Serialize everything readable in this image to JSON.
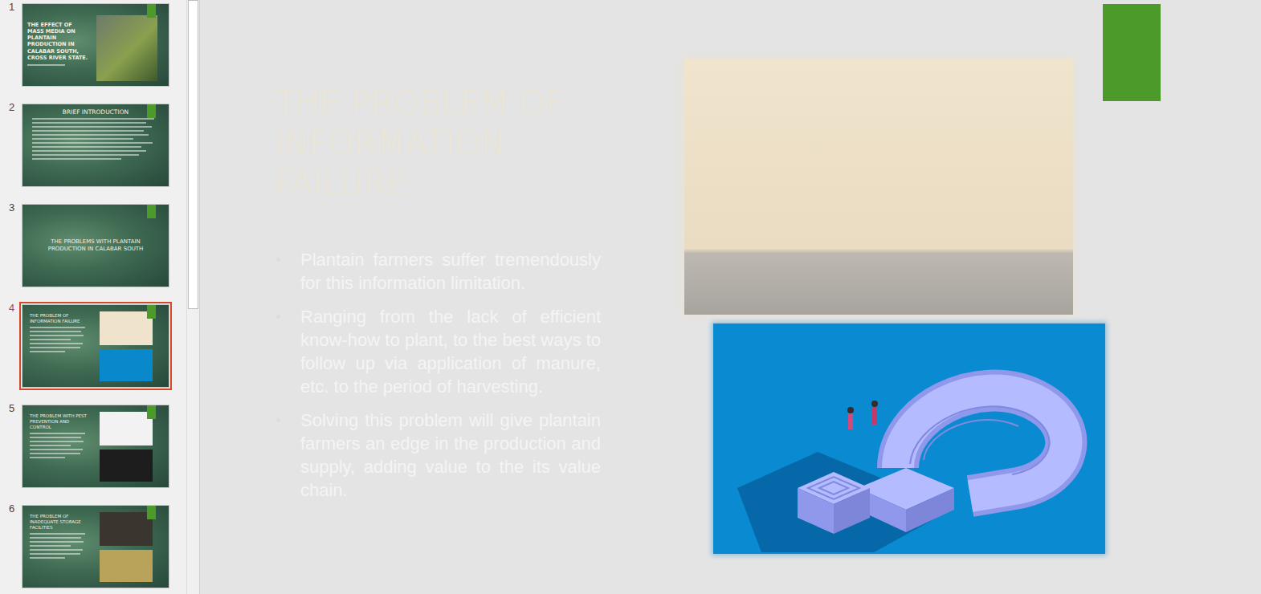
{
  "slides": [
    {
      "number": "1",
      "title": "THE EFFECT OF MASS MEDIA ON PLANTAIN PRODUCTION IN CALABAR SOUTH, CROSS RIVER STATE.",
      "selected": false,
      "kind": "cover"
    },
    {
      "number": "2",
      "title": "BRIEF INTRODUCTION",
      "selected": false,
      "kind": "bullets"
    },
    {
      "number": "3",
      "title": "THE PROBLEMS WITH PLANTAIN PRODUCTION IN CALABAR SOUTH",
      "selected": false,
      "kind": "section"
    },
    {
      "number": "4",
      "title": "THE PROBLEM OF INFORMATION FAILURE",
      "selected": true,
      "kind": "pictures"
    },
    {
      "number": "5",
      "title": "THE PROBLEM WITH PEST PREVENTION AND CONTROL",
      "selected": false,
      "kind": "pictures"
    },
    {
      "number": "6",
      "title": "THE PROBLEM OF INADEQUATE STORAGE FACILITIES",
      "selected": false,
      "kind": "pictures"
    }
  ],
  "scrollbar": {
    "level": 0.52
  },
  "slide": {
    "title": [
      "THE PROBLEM OF",
      "INFORMATION",
      "FAILURE"
    ],
    "bullets": [
      "Plantain farmers suffer tremendously for this information limitation.",
      "Ranging from the lack of efficient know-how to plant, to the best ways to follow up via application of manure, etc. to the period of harvesting.",
      "Solving this problem will give plantain farmers an edge in the production and supply, adding value to the its value chain."
    ]
  }
}
